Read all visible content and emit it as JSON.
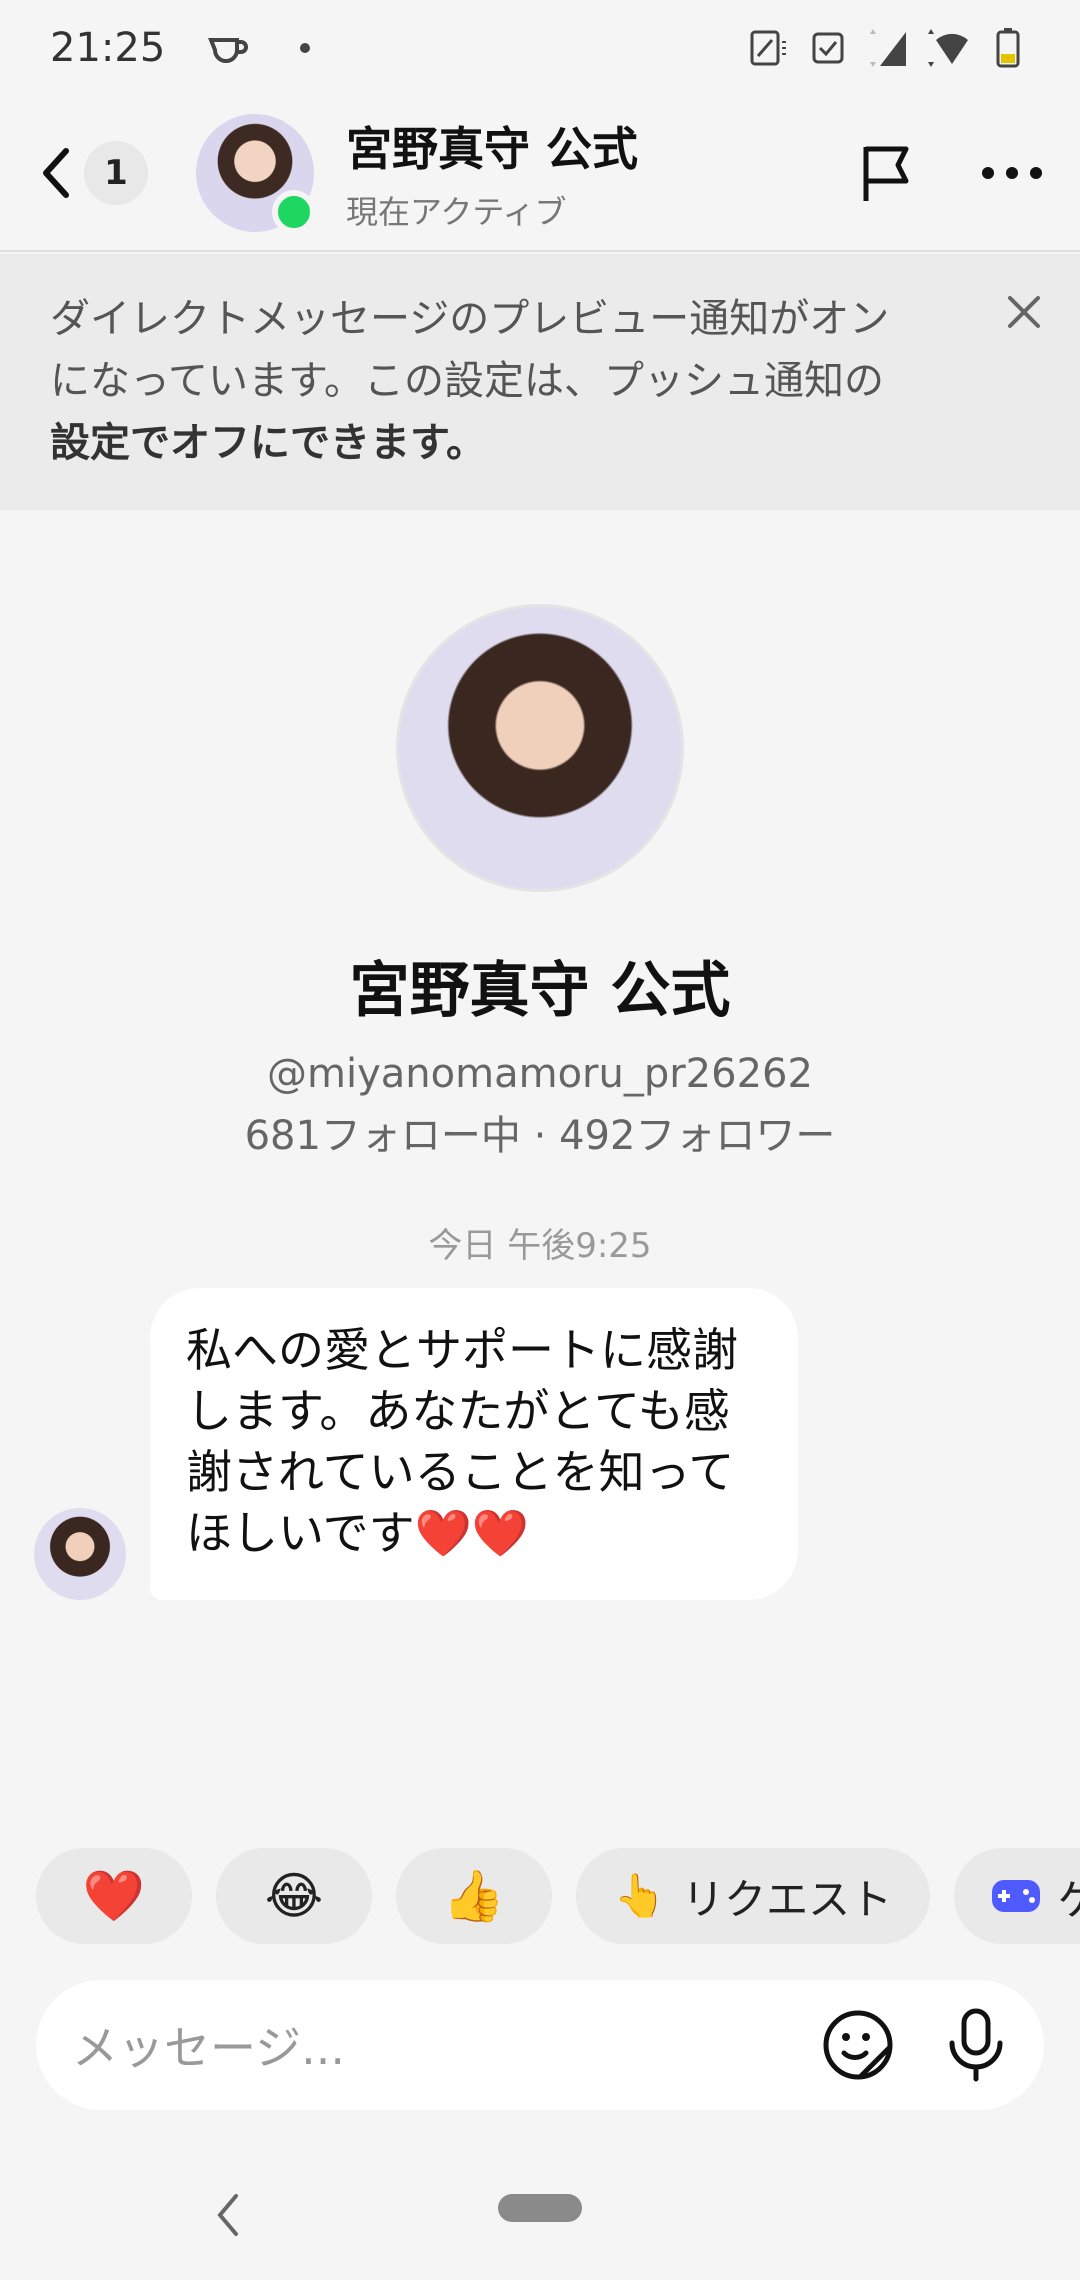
{
  "status_bar": {
    "time": "21:25",
    "icons": [
      "coffee-icon",
      "dot-icon",
      "nfc-icon",
      "alarm-icon",
      "signal-icon",
      "wifi-icon",
      "battery-icon"
    ]
  },
  "header": {
    "back_count": "1",
    "name": "宮野真守 公式",
    "status": "現在アクティブ",
    "online_color": "#1ed760"
  },
  "notice": {
    "text_line1": "ダイレクトメッセージのプレビュー通知がオン",
    "text_line2": "になっています。この設定は、プッシュ通知の",
    "text_line3_a": "設定",
    "text_line3_b": "でオフにできます。"
  },
  "profile": {
    "name": "宮野真守 公式",
    "handle": "@miyanomamoru_pr26262",
    "stats": "681フォロー中 · 492フォロワー"
  },
  "conversation": {
    "timestamp": "今日 午後9:25",
    "message_line1": "私への愛とサポートに感謝",
    "message_line2": "します。あなたがとても感",
    "message_line3": "謝されていることを知って",
    "message_line4": "ほしいです❤️❤️"
  },
  "quick_replies": {
    "heart": "❤️",
    "laugh": "😂",
    "thumbs": "👍",
    "request_emoji": "👆",
    "request_label": "リクエスト",
    "game_label": "ゲ"
  },
  "composer": {
    "placeholder": "メッセージ..."
  }
}
